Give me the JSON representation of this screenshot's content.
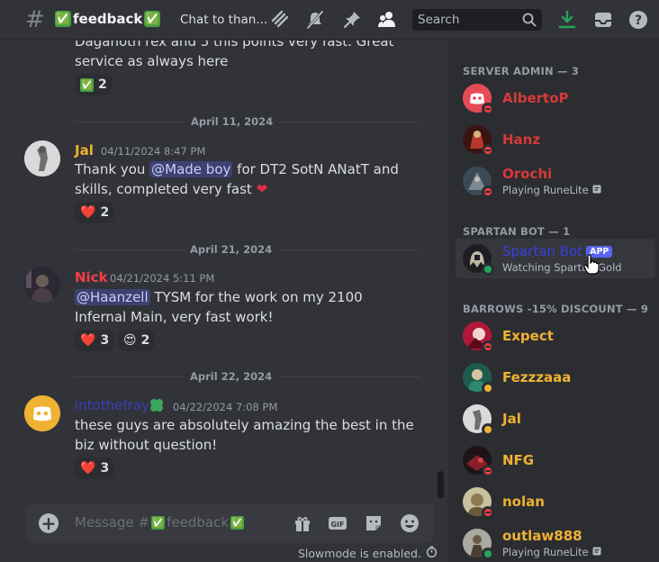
{
  "header": {
    "channel_prefix": "✅",
    "channel_name": "feedback",
    "channel_suffix": "✅",
    "topic": "Chat to than...",
    "search_placeholder": "Search"
  },
  "messages": {
    "partial_text": "Daganoth rex and 5 this points very fast. Great service as always here",
    "partial_reaction": {
      "emoji": "✅",
      "count": "2"
    },
    "dividers": [
      "April 11, 2024",
      "April 21, 2024",
      "April 22, 2024"
    ],
    "items": [
      {
        "author": "Jal",
        "author_color": "#f0b232",
        "timestamp": "04/11/2024 8:47 PM",
        "text_before": "Thank you ",
        "mention": "@Made boy",
        "text_after": " for DT2 SotN ANatT and skills, completed very fast",
        "reactions": [
          {
            "emoji": "❤️",
            "count": "2"
          }
        ]
      },
      {
        "author": "Nick",
        "author_color": "#f23f43",
        "timestamp": "04/21/2024 5:11 PM",
        "mention": "@Haanzell",
        "text_after": " TYSM for the work on my 2100 Infernal Main, very fast work!",
        "reactions": [
          {
            "emoji": "❤️",
            "count": "3"
          },
          {
            "emoji": "😍",
            "count": "2"
          }
        ]
      },
      {
        "author": "intothefray",
        "author_color": "#3b3fbf",
        "timestamp": "04/22/2024 7:08 PM",
        "text": "these guys are absolutely amazing the best in the biz without question!",
        "reactions": [
          {
            "emoji": "❤️",
            "count": "3"
          }
        ]
      }
    ]
  },
  "composer": {
    "placeholder_prefix": "Message #",
    "placeholder_channel": "feedback",
    "slowmode": "Slowmode is enabled."
  },
  "members": {
    "sections": [
      {
        "title": "SERVER ADMIN — 3"
      },
      {
        "title": "SPARTAN BOT — 1"
      },
      {
        "title": "BARROWS -15% DISCOUNT — 9"
      }
    ],
    "admins": [
      {
        "name": "AlbertoP",
        "color": "#d63a3a",
        "status": "dnd"
      },
      {
        "name": "Hanz",
        "color": "#d63a3a",
        "status": "dnd"
      },
      {
        "name": "Orochi",
        "color": "#d63a3a",
        "status": "dnd",
        "activity": "Playing RuneLite"
      }
    ],
    "bot": {
      "name": "Spartan Bot",
      "color": "#3b3fdf",
      "badge": "APP",
      "status": "online",
      "activity": "Watching Spartan Gold"
    },
    "barrows": [
      {
        "name": "Expect",
        "color": "#f0b232",
        "status": "dnd"
      },
      {
        "name": "Fezzzaaa",
        "color": "#f0b232",
        "status": "idle"
      },
      {
        "name": "Jal",
        "color": "#f0b232",
        "status": "idle"
      },
      {
        "name": "NFG",
        "color": "#f0b232",
        "status": "dnd"
      },
      {
        "name": "nolan",
        "color": "#f0b232",
        "status": "dnd"
      },
      {
        "name": "outlaw888",
        "color": "#f0b232",
        "status": "online",
        "activity": "Playing RuneLite"
      }
    ]
  },
  "colors": {
    "background": "#313338",
    "sidebar": "#2b2d31",
    "accent": "#5865f2",
    "download_icon": "#23a55a"
  }
}
